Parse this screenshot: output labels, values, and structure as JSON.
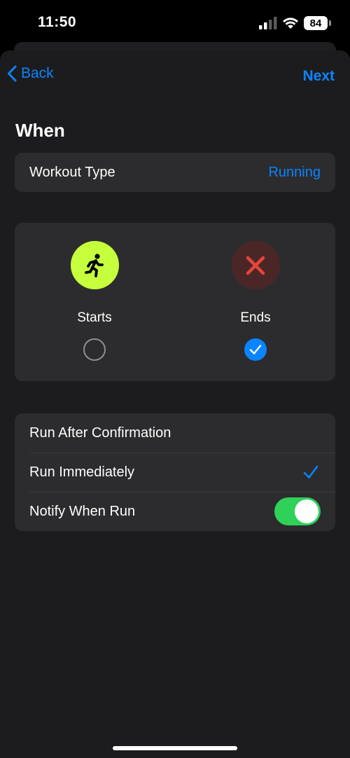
{
  "status_bar": {
    "time": "11:50",
    "battery": "84",
    "cellular_icon": "cellular-signal-icon",
    "wifi_icon": "wifi-icon"
  },
  "nav": {
    "back_label": "Back",
    "next_label": "Next",
    "back_icon": "chevron-left-icon"
  },
  "section_title": "When",
  "workout": {
    "label": "Workout Type",
    "value": "Running"
  },
  "triggers": {
    "starts": {
      "label": "Starts",
      "icon": "running-figure-icon",
      "selected": false
    },
    "ends": {
      "label": "Ends",
      "icon": "x-mark-icon",
      "selected": true
    }
  },
  "options": {
    "run_after_confirmation": "Run After Confirmation",
    "run_immediately": "Run Immediately",
    "run_immediately_checked": true,
    "notify_when_run": "Notify When Run",
    "notify_when_run_on": true
  },
  "colors": {
    "accent": "#0a84ff",
    "run_icon_bg": "#c6ff3c",
    "end_icon_bg": "#4a2726",
    "end_icon_fg": "#e8453c",
    "toggle_on": "#30d158",
    "sheet_bg": "#1c1c1e",
    "card_bg": "#2c2c2e"
  }
}
